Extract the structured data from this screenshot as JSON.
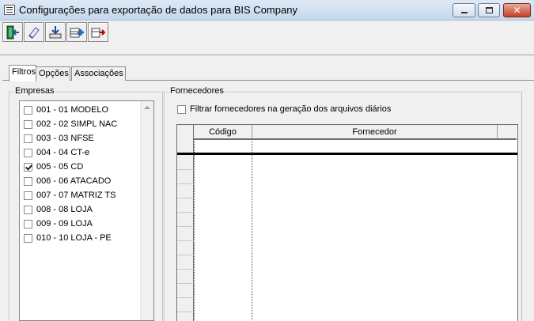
{
  "window": {
    "title": "Configurações para exportação de dados para BIS Company",
    "close_glyph": "✕"
  },
  "toolbar": {
    "buttons": [
      {
        "icon": "exit-door-icon",
        "color": "#1e7a3c"
      },
      {
        "icon": "eraser-icon",
        "color": "#6060a0"
      },
      {
        "icon": "import-tray-icon",
        "color": "#2050a0"
      },
      {
        "icon": "add-record-icon",
        "color": "#2070c0"
      },
      {
        "icon": "delete-record-icon",
        "color": "#c00000"
      }
    ]
  },
  "tabs": [
    {
      "label": "Filtros",
      "active": true
    },
    {
      "label": "Opções",
      "active": false
    },
    {
      "label": "Associações",
      "active": false
    }
  ],
  "empresas": {
    "legend": "Empresas",
    "items": [
      {
        "label": "001 - 01 MODELO",
        "checked": false
      },
      {
        "label": "002 - 02 SIMPL NAC",
        "checked": false
      },
      {
        "label": "003 - 03 NFSE",
        "checked": false
      },
      {
        "label": "004 - 04 CT-e",
        "checked": false
      },
      {
        "label": "005 - 05 CD",
        "checked": true
      },
      {
        "label": "006 - 06 ATACADO",
        "checked": false
      },
      {
        "label": "007 - 07 MATRIZ TS",
        "checked": false
      },
      {
        "label": "008 - 08 LOJA",
        "checked": false
      },
      {
        "label": "009 - 09 LOJA",
        "checked": false
      },
      {
        "label": "010 - 10 LOJA - PE",
        "checked": false
      }
    ]
  },
  "fornecedores": {
    "legend": "Fornecedores",
    "filter_label": "Filtrar fornecedores na geração dos arquivos diários",
    "filter_checked": false,
    "columns": [
      "Código",
      "Fornecedor"
    ]
  }
}
